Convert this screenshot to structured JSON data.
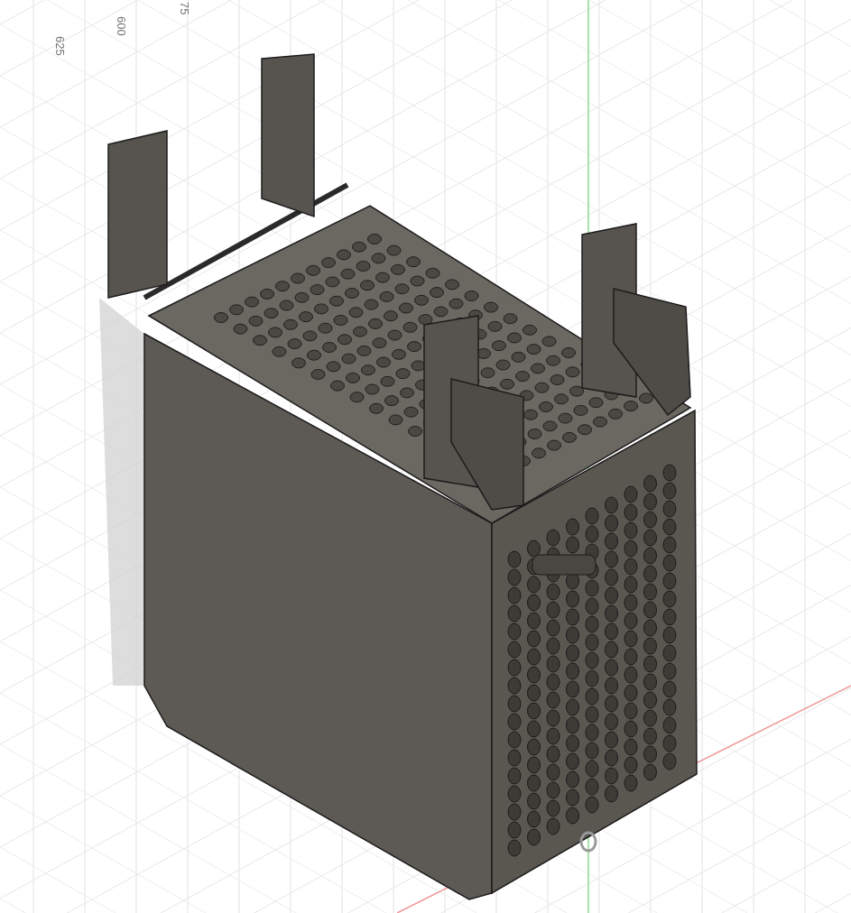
{
  "viewport": {
    "ruler_labels": [
      "75",
      "600",
      "625"
    ]
  }
}
